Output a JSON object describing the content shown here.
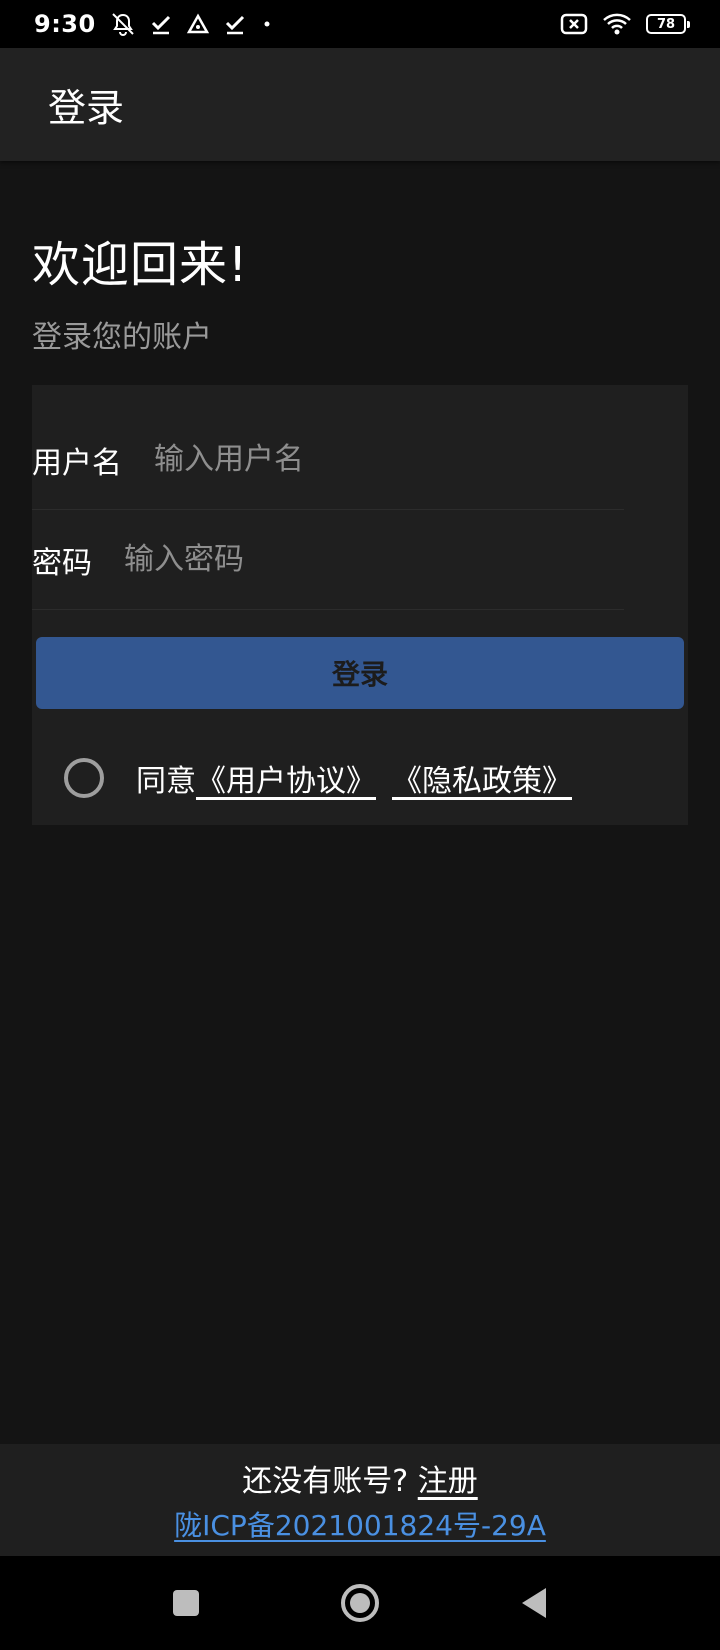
{
  "status_bar": {
    "time": "9:30",
    "battery": "78",
    "icons": [
      "bell-off-icon",
      "check-icon",
      "triangle-icon",
      "check-icon",
      "dot-icon",
      "sim-x-icon",
      "wifi-icon",
      "battery-icon"
    ]
  },
  "app_bar": {
    "title": "登录"
  },
  "welcome": {
    "title": "欢迎回来!",
    "subtitle": "登录您的账户"
  },
  "form": {
    "username_label": "用户名",
    "username_placeholder": "输入用户名",
    "username_value": "",
    "password_label": "密码",
    "password_placeholder": "输入密码",
    "password_value": "",
    "login_button": "登录"
  },
  "agreement": {
    "prefix": "同意",
    "user_agreement": "《用户协议》",
    "privacy_policy": "《隐私政策》",
    "checked": false
  },
  "footer": {
    "no_account": "还没有账号?",
    "register": "注册",
    "icp": "陇ICP备2021001824号-29A"
  },
  "colors": {
    "background": "#141414",
    "card": "#1f1f1f",
    "app_bar": "#222222",
    "button": "#335791",
    "link_blue": "#4a90e2"
  }
}
